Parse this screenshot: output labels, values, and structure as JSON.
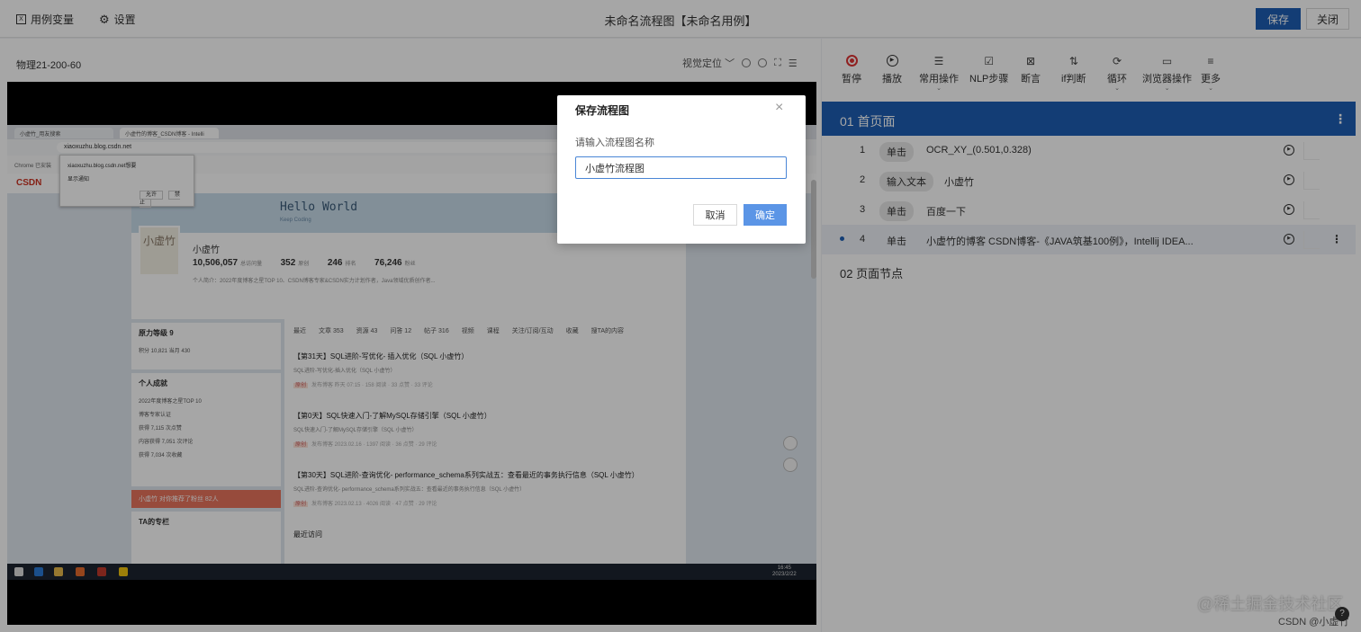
{
  "topbar": {
    "variables_label": "用例变量",
    "settings_label": "设置",
    "title": "未命名流程图【未命名用例】",
    "save_label": "保存",
    "close_label": "关闭"
  },
  "left": {
    "device_label": "物理21-200-60",
    "visual_position_label": "视觉定位"
  },
  "screenshot": {
    "tabs": [
      "小虚竹_用友搜索",
      "小虚竹的博客_CSDN博客 - Intelli"
    ],
    "url": "xiaoxuzhu.blog.csdn.net",
    "bookmarks": "Chrome 已安装",
    "popup_title": "xiaoxuzhu.blog.csdn.net想要",
    "popup_line": "显示通知",
    "popup_allow": "允许",
    "popup_block": "禁止",
    "csdn_logo": "CSDN",
    "banner_title": "Hello World",
    "banner_sub": "Keep Coding",
    "avatar_text": "小虚竹",
    "profile_name": "小虚竹",
    "stats": [
      {
        "value": "10,506,057",
        "label": "总访问量"
      },
      {
        "value": "352",
        "label": "原创"
      },
      {
        "value": "246",
        "label": "排名"
      },
      {
        "value": "76,246",
        "label": "粉丝"
      }
    ],
    "intro": "个人简介：2022年度博客之星TOP 10、CSDN博客专家&CSDN实力计划作者，Java领域优质创作者...",
    "power_title": "原力等级",
    "power_level": "9",
    "power_score": "积分 10,821  当月 430",
    "achievement_title": "个人成就",
    "achievements": [
      "2022年度博客之星TOP 10",
      "博客专家认证",
      "获得 7,115 次点赞",
      "内容获得 7,051 次评论",
      "获得 7,034 次收藏"
    ],
    "red_bar": "小虚竹 对你推荐了粉丝 82人",
    "column_title": "TA的专栏",
    "content_tabs": [
      "最近",
      "文章 353",
      "资源 43",
      "问答 12",
      "帖子 316",
      "视频",
      "课程",
      "关注/订阅/互动",
      "收藏",
      "搜TA的内容"
    ],
    "articles": [
      {
        "title": "【第31天】SQL进阶-写优化- 插入优化（SQL 小虚竹）",
        "sub": "SQL进阶-写优化-插入优化（SQL 小虚竹）",
        "meta": "发布博客 昨天 07:15 · 158 阅读 · 33 点赞 · 33 评论"
      },
      {
        "title": "【第0天】SQL快速入门-了解MySQL存储引擎（SQL 小虚竹）",
        "sub": "SQL快速入门-了解MySQL存储引擎（SQL 小虚竹）",
        "meta": "发布博客 2023.02.16 · 1397 阅读 · 36 点赞 · 29 评论"
      },
      {
        "title": "【第30天】SQL进阶-查询优化- performance_schema系列实战五：查看最近的事务执行信息（SQL 小虚竹）",
        "sub": "SQL进阶-查询优化- performance_schema系列实战五：查看最近的事务执行信息（SQL 小虚竹）",
        "meta": "发布博客 2023.02.13 · 4026 阅读 · 47 点赞 · 29 评论"
      }
    ],
    "visitor_label": "最近访问",
    "clock_time": "16:45",
    "clock_date": "2023/2/22"
  },
  "toolbar": [
    {
      "label": "暂停",
      "icon": "record-icon"
    },
    {
      "label": "播放",
      "icon": "play-icon"
    },
    {
      "label": "常用操作",
      "icon": "list-icon"
    },
    {
      "label": "NLP步骤",
      "icon": "nlp-icon"
    },
    {
      "label": "断言",
      "icon": "assert-icon"
    },
    {
      "label": "if判断",
      "icon": "if-icon"
    },
    {
      "label": "循环",
      "icon": "loop-icon"
    },
    {
      "label": "浏览器操作",
      "icon": "browser-icon"
    },
    {
      "label": "更多",
      "icon": "more-icon"
    }
  ],
  "flow": {
    "page1": "01   首页面",
    "steps": [
      {
        "num": "1",
        "action": "单击",
        "text": "OCR_XY_(0.501,0.328)"
      },
      {
        "num": "2",
        "action": "输入文本",
        "text": "小虚竹"
      },
      {
        "num": "3",
        "action": "单击",
        "text": "百度一下"
      },
      {
        "num": "4",
        "action": "单击",
        "text": "小虚竹的博客 CSDN博客-《JAVA筑基100例》，Intellij IDEA..."
      }
    ],
    "page2": "02   页面节点"
  },
  "dialog": {
    "title": "保存流程图",
    "label": "请输入流程图名称",
    "input_value": "小虚竹流程图",
    "cancel_label": "取消",
    "ok_label": "确定"
  },
  "watermark": "@稀土掘金技术社区",
  "watermark2": "CSDN @小虚竹",
  "colors": {
    "primary": "#1e5fb4",
    "record": "#d33333",
    "ok_button": "#5b95e6"
  }
}
